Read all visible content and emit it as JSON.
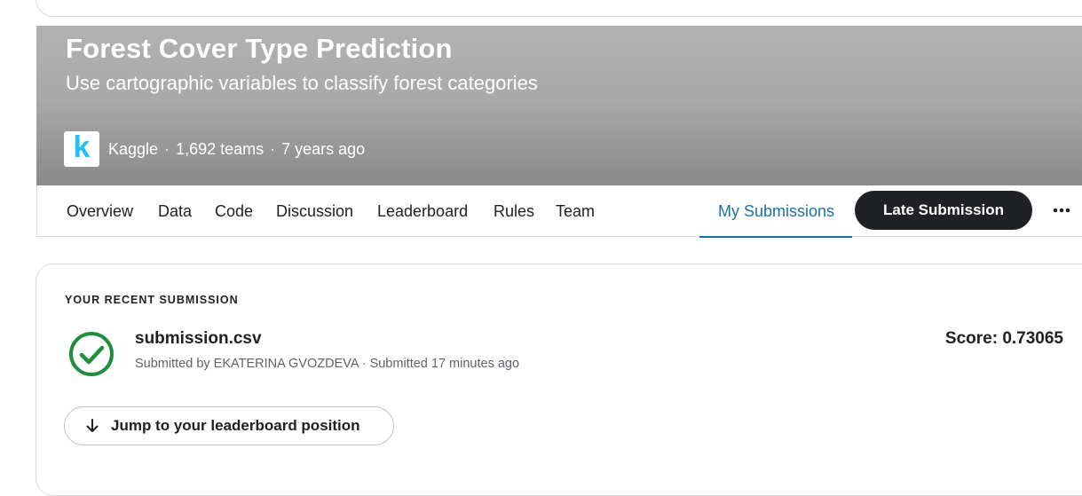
{
  "banner": {
    "title": "Forest Cover Type Prediction",
    "subtitle": "Use cartographic variables to classify forest categories",
    "logo_letter": "k",
    "host": "Kaggle",
    "teams": "1,692 teams",
    "age": "7 years ago",
    "separator": "·"
  },
  "nav": {
    "tabs": [
      {
        "label": "Overview"
      },
      {
        "label": "Data"
      },
      {
        "label": "Code"
      },
      {
        "label": "Discussion"
      },
      {
        "label": "Leaderboard"
      },
      {
        "label": "Rules"
      },
      {
        "label": "Team"
      },
      {
        "label": "My Submissions",
        "active": true
      }
    ],
    "late_submission_label": "Late Submission",
    "more_icon": "more-horizontal-icon"
  },
  "submission": {
    "heading": "YOUR RECENT SUBMISSION",
    "status_icon": "check-circle-icon",
    "file_name": "submission.csv",
    "submitted_by": "Submitted by EKATERINA GVOZDEVA · Submitted 17 minutes ago",
    "score": "Score: 0.73065",
    "jump_label": "Jump to your leaderboard position",
    "jump_icon": "arrow-down-icon"
  },
  "colors": {
    "accent": "#1a73a8",
    "success": "#1e8e3e",
    "dark_button": "#202124",
    "kaggle_blue": "#20beff"
  }
}
